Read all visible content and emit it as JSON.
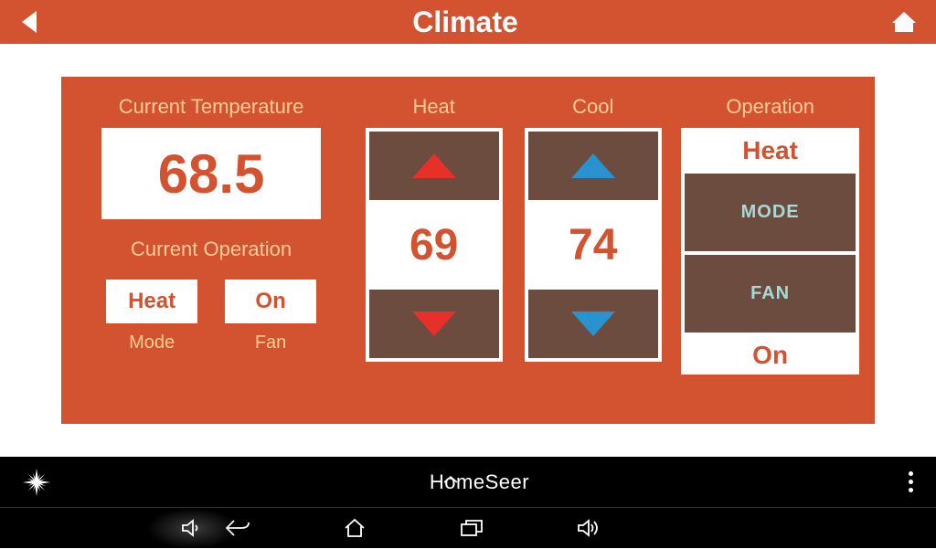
{
  "header": {
    "title": "Climate"
  },
  "current_temp": {
    "label": "Current Temperature",
    "value": "68.5"
  },
  "current_operation": {
    "label": "Current Operation",
    "mode_value": "Heat",
    "mode_label": "Mode",
    "fan_value": "On",
    "fan_label": "Fan"
  },
  "heat": {
    "label": "Heat",
    "value": "69"
  },
  "cool": {
    "label": "Cool",
    "value": "74"
  },
  "operation": {
    "label": "Operation",
    "mode_status": "Heat",
    "mode_button": "MODE",
    "fan_button": "FAN",
    "fan_status": "On"
  },
  "brand": {
    "part1": "H",
    "part2": "o",
    "part3": "meSeer"
  },
  "colors": {
    "primary": "#D35230",
    "button_bg": "#6B4C3F",
    "label": "#FFCC99",
    "button_text": "#A8D8D8",
    "heat_arrow": "#E8302A",
    "cool_arrow": "#2993D0"
  }
}
